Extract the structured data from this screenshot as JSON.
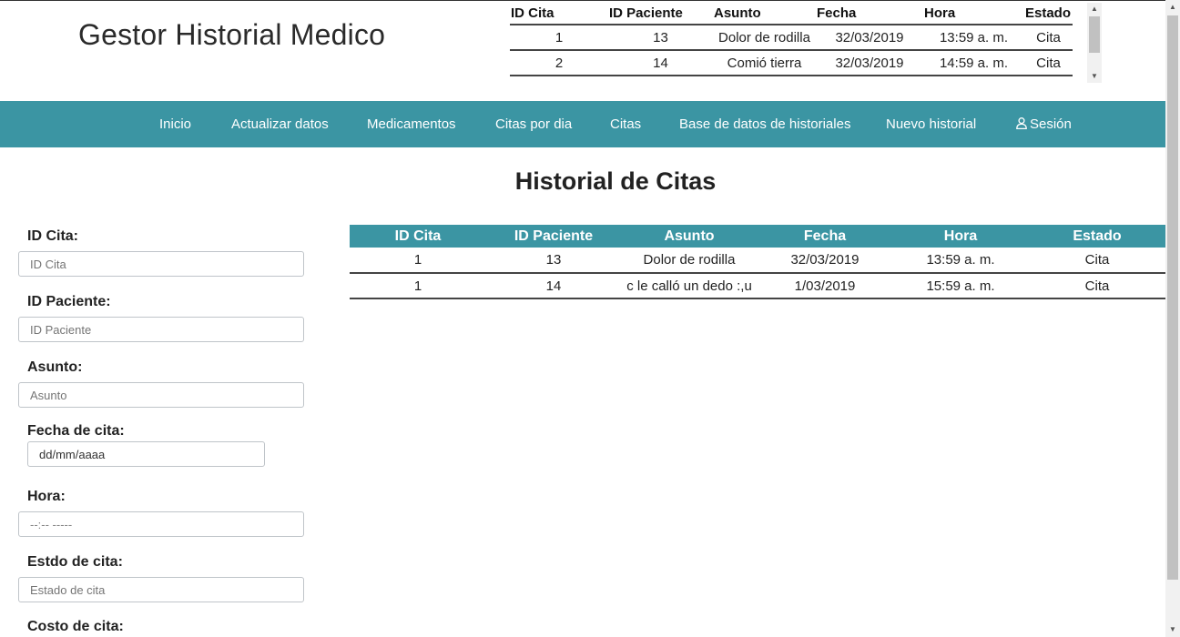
{
  "app": {
    "title": "Gestor Historial Medico"
  },
  "mini_table": {
    "headers": [
      "ID Cita",
      "ID Paciente",
      "Asunto",
      "Fecha",
      "Hora",
      "Estado"
    ],
    "rows": [
      [
        "1",
        "13",
        "Dolor de rodilla",
        "32/03/2019",
        "13:59 a. m.",
        "Cita"
      ],
      [
        "2",
        "14",
        "Comió tierra",
        "32/03/2019",
        "14:59 a. m.",
        "Cita"
      ]
    ]
  },
  "nav": {
    "items": [
      "Inicio",
      "Actualizar datos",
      "Medicamentos",
      "Citas por dia",
      "Citas",
      "Base de datos de historiales",
      "Nuevo historial"
    ],
    "session_label": "Sesión"
  },
  "section": {
    "title": "Historial de Citas"
  },
  "form": {
    "id_cita": {
      "label": "ID Cita:",
      "placeholder": "ID Cita"
    },
    "id_paciente": {
      "label": "ID Paciente:",
      "placeholder": "ID Paciente"
    },
    "asunto": {
      "label": "Asunto:",
      "placeholder": "Asunto"
    },
    "fecha": {
      "label": "Fecha de cita:",
      "placeholder": "dd/mm/aaaa"
    },
    "hora": {
      "label": "Hora:",
      "placeholder": "--:-- -----"
    },
    "estado": {
      "label": "Estdo de cita:",
      "placeholder": "Estado de cita"
    },
    "costo": {
      "label": "Costo de cita:"
    }
  },
  "main_table": {
    "headers": [
      "ID Cita",
      "ID Paciente",
      "Asunto",
      "Fecha",
      "Hora",
      "Estado"
    ],
    "rows": [
      [
        "1",
        "13",
        "Dolor de rodilla",
        "32/03/2019",
        "13:59 a. m.",
        "Cita"
      ],
      [
        "1",
        "14",
        "c le calló un dedo :,u",
        "1/03/2019",
        "15:59 a. m.",
        "Cita"
      ]
    ]
  },
  "colors": {
    "accent": "#3b95a3",
    "header_text": "#ffffff"
  }
}
